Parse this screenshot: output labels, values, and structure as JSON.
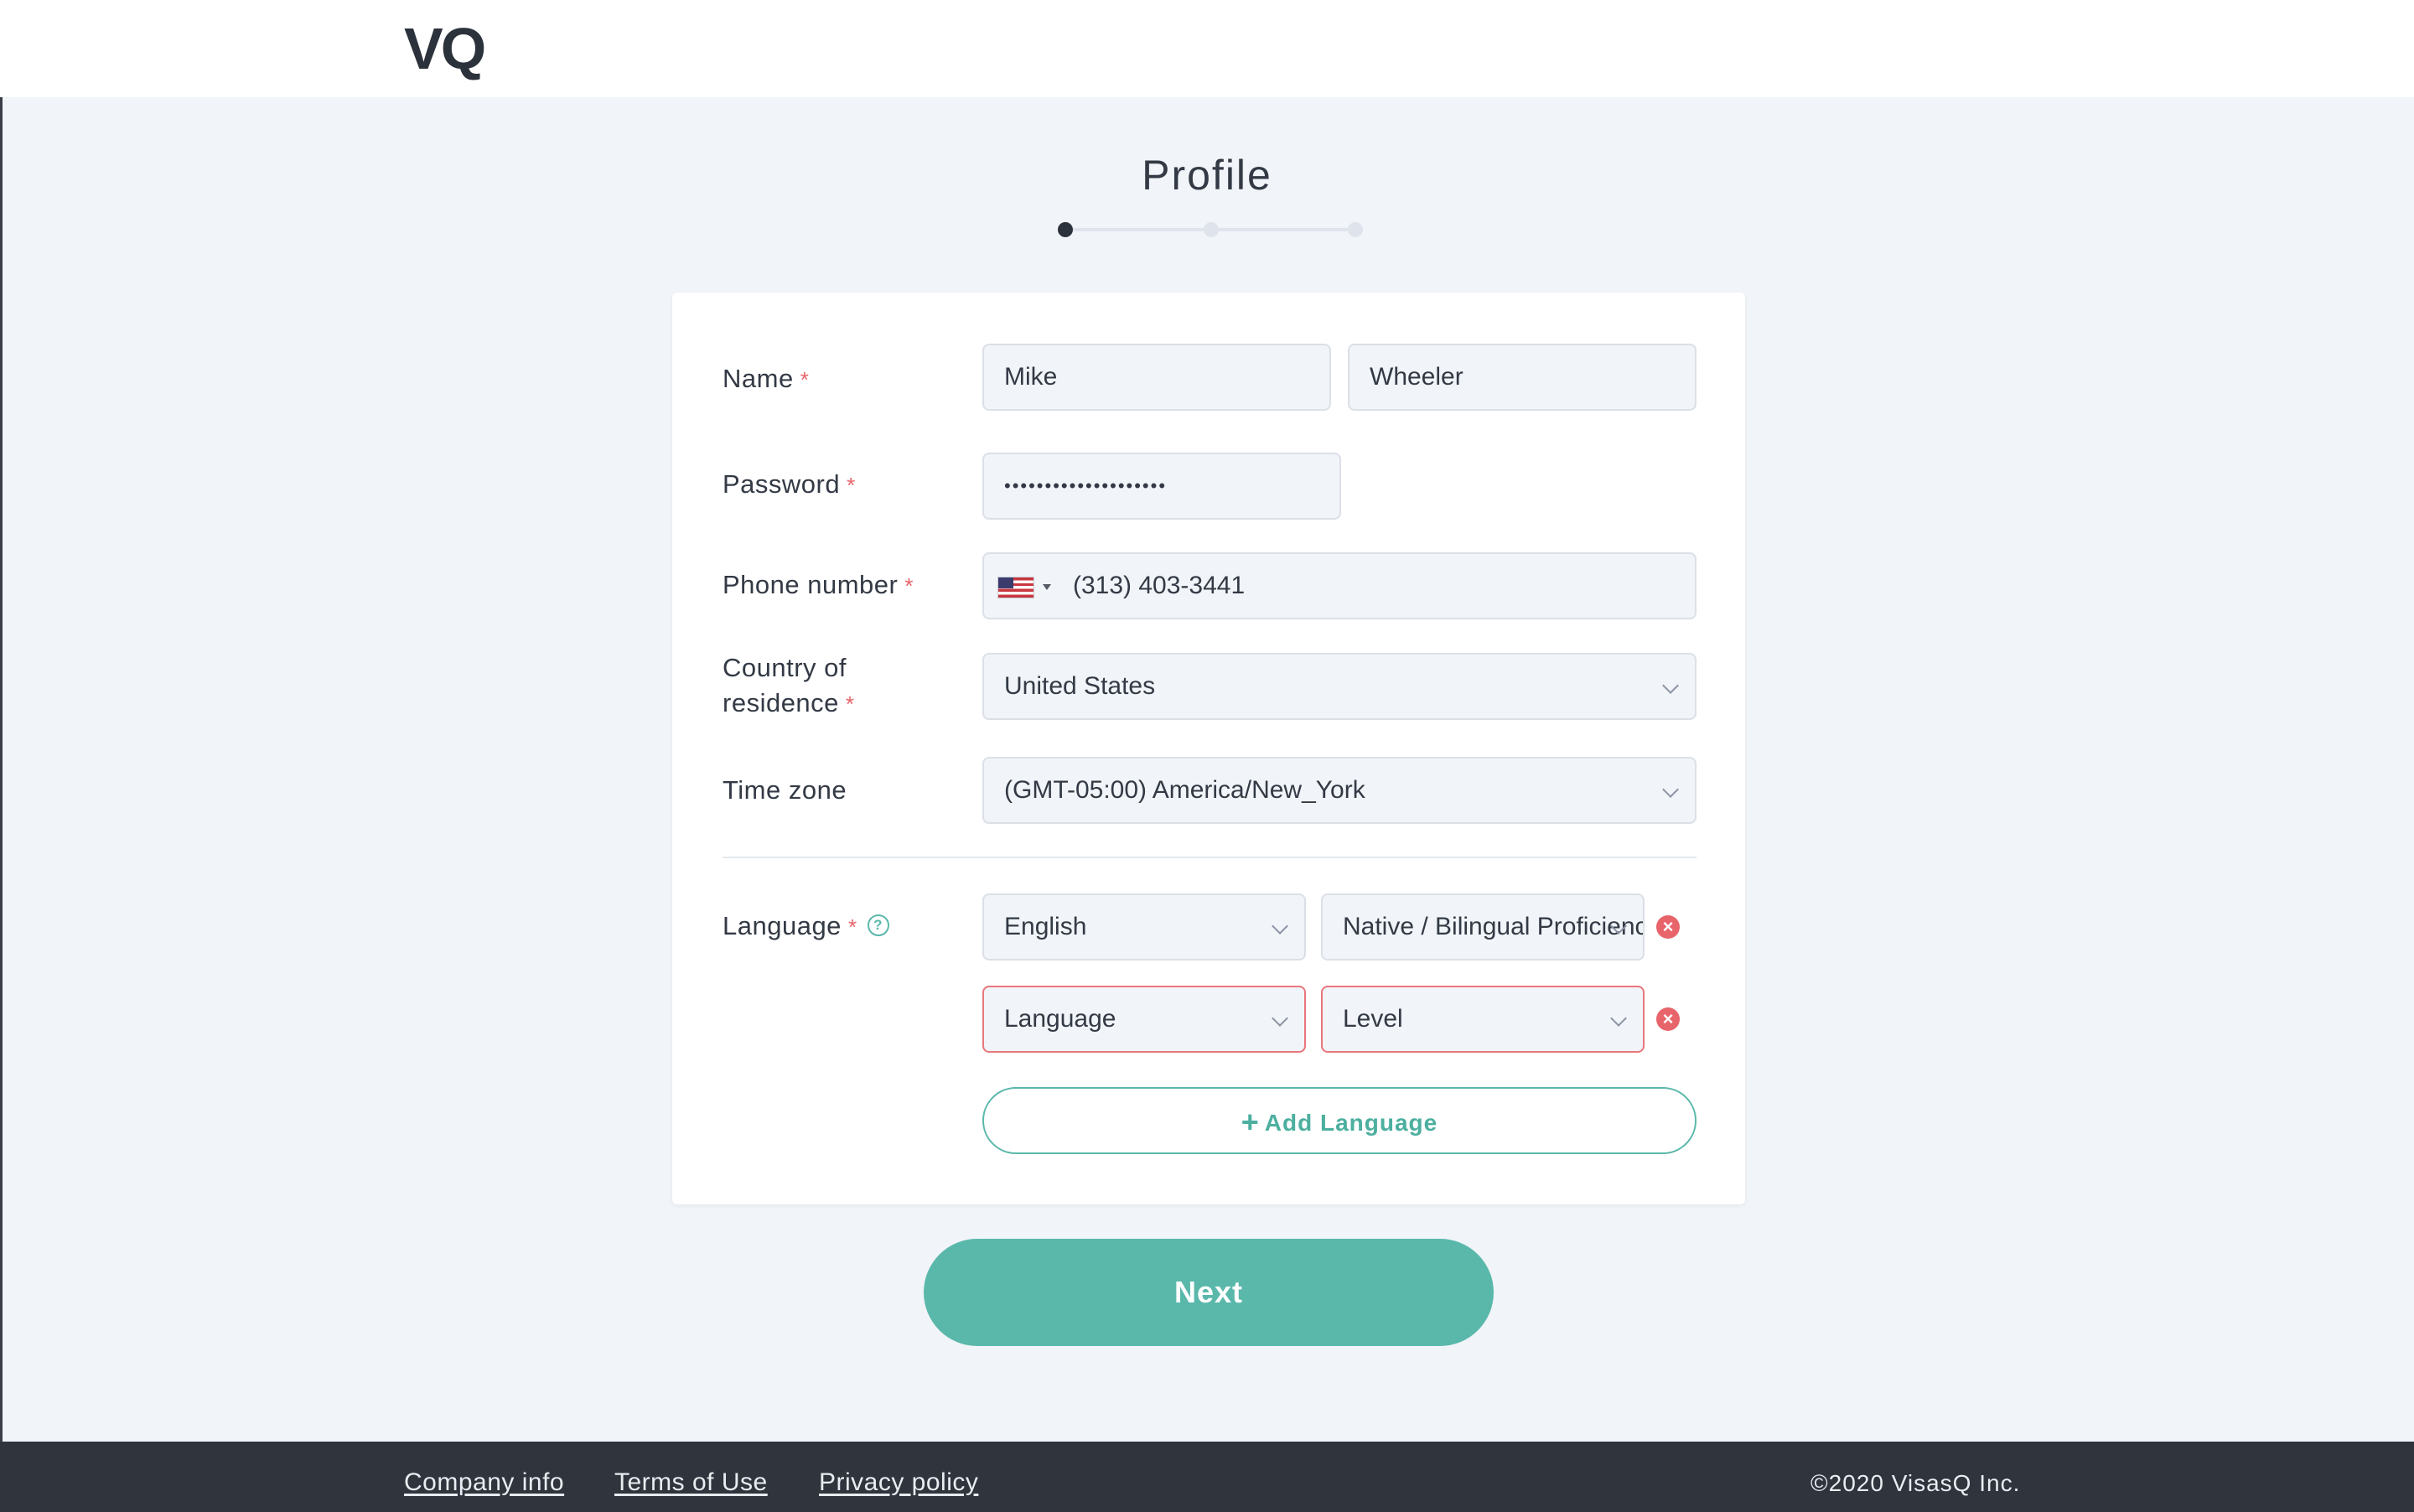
{
  "header": {
    "logo": "VQ"
  },
  "page": {
    "title": "Profile",
    "steps": {
      "total": 3,
      "current": 1
    }
  },
  "form": {
    "name": {
      "label": "Name",
      "required_mark": "*",
      "first": "Mike",
      "last": "Wheeler"
    },
    "password": {
      "label": "Password",
      "required_mark": "*",
      "value": "••••••••••••••••••••"
    },
    "phone": {
      "label": "Phone number",
      "required_mark": "*",
      "country_flag": "us-flag-icon",
      "value": "(313) 403-3441"
    },
    "country": {
      "label_line1": "Country of",
      "label_line2": "residence",
      "required_mark": "*",
      "value": "United States"
    },
    "timezone": {
      "label": "Time zone",
      "value": "(GMT-05:00) America/New_York"
    },
    "language": {
      "label": "Language",
      "required_mark": "*",
      "help": "?",
      "rows": [
        {
          "language": "English",
          "level": "Native / Bilingual Proficiency",
          "error": false
        },
        {
          "language": "Language",
          "level": "Level",
          "error": true
        }
      ],
      "add_plus": "+",
      "add_label": "Add Language"
    }
  },
  "actions": {
    "next_label": "Next"
  },
  "footer": {
    "links": [
      "Company info",
      "Terms of Use",
      "Privacy policy"
    ],
    "copyright": "©2020 VisasQ Inc."
  },
  "colors": {
    "accent": "#5ab8ab",
    "error": "#e8646b",
    "footer_bg": "#2f343d",
    "page_bg": "#f1f4f8"
  }
}
